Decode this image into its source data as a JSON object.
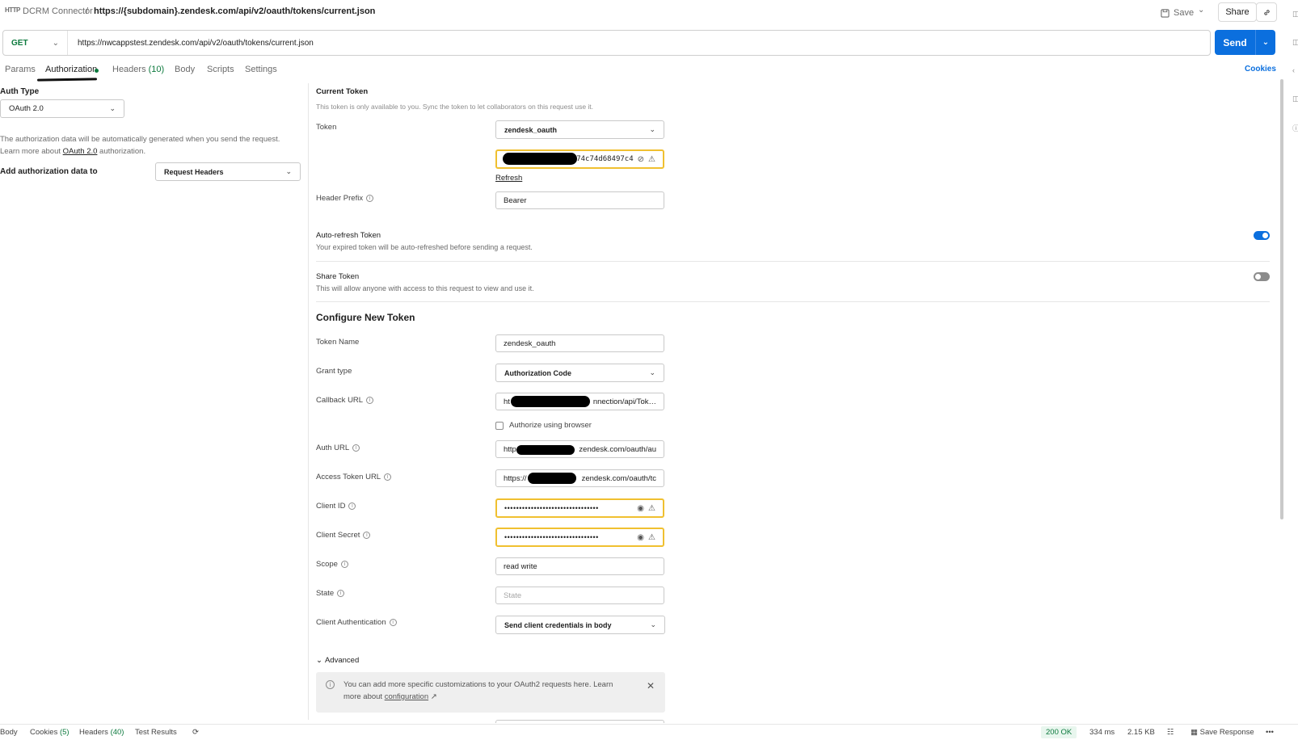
{
  "header": {
    "http_badge": "HTTP",
    "collection": "DCRM Connector",
    "separator": "/",
    "title": "https://{subdomain}.zendesk.com/api/v2/oauth/tokens/current.json",
    "save_label": "Save",
    "share_label": "Share"
  },
  "request": {
    "method": "GET",
    "url": "https://nwcappstest.zendesk.com/api/v2/oauth/tokens/current.json",
    "send_label": "Send"
  },
  "tabs": [
    {
      "label": "Params",
      "active": false
    },
    {
      "label": "Authorization",
      "active": true
    },
    {
      "label": "Headers",
      "count": "(10)",
      "active": false
    },
    {
      "label": "Body",
      "active": false
    },
    {
      "label": "Scripts",
      "active": false
    },
    {
      "label": "Settings",
      "active": false
    }
  ],
  "cookies_label": "Cookies",
  "auth": {
    "type_label": "Auth Type",
    "type_value": "OAuth 2.0",
    "info_line1": "The authorization data will be automatically generated when you send the request.",
    "info_prefix": "Learn more about ",
    "info_link": "OAuth 2.0",
    "info_suffix": " authorization.",
    "add_to_label": "Add authorization data to",
    "add_to_value": "Request Headers"
  },
  "current_token": {
    "title": "Current Token",
    "note": "This token is only available to you. Sync the token to let collaborators on this request use it.",
    "token_label": "Token",
    "token_name": "zendesk_oauth",
    "token_value": "74c74d68497c4",
    "refresh_label": "Refresh",
    "header_prefix_label": "Header Prefix",
    "header_prefix_value": "Bearer",
    "auto_refresh_title": "Auto-refresh Token",
    "auto_refresh_desc": "Your expired token will be auto-refreshed before sending a request.",
    "auto_refresh_on": true,
    "share_title": "Share Token",
    "share_desc": "This will allow anyone with access to this request to view and use it.",
    "share_on": false
  },
  "configure": {
    "title": "Configure New Token",
    "token_name_label": "Token Name",
    "token_name_value": "zendesk_oauth",
    "grant_type_label": "Grant type",
    "grant_type_value": "Authorization Code",
    "callback_label": "Callback URL",
    "callback_start": "ht",
    "callback_value": "nnection/api/Tok…",
    "authorize_browser_label": "Authorize using browser",
    "auth_url_label": "Auth URL",
    "auth_url_start": "http",
    "auth_url_value": "zendesk.com/oauth/au",
    "access_token_url_label": "Access Token URL",
    "access_token_url_start": "https://",
    "access_token_url_value": "zendesk.com/oauth/tc",
    "client_id_label": "Client ID",
    "client_id_value": "••••••••••••••••••••••••••••••••",
    "client_secret_label": "Client Secret",
    "client_secret_value": "••••••••••••••••••••••••••••••••",
    "scope_label": "Scope",
    "scope_value": "read write",
    "state_label": "State",
    "state_placeholder": "State",
    "client_auth_label": "Client Authentication",
    "client_auth_value": "Send client credentials in body",
    "advanced_label": "Advanced",
    "advanced_note_prefix": "You can add more specific customizations to your OAuth2 requests here. Learn more about ",
    "advanced_note_link": "configuration",
    "advanced_note_suffix": " ↗"
  },
  "footer": {
    "body": "Body",
    "cookies": "Cookies",
    "cookies_count": "(5)",
    "headers": "Headers",
    "headers_count": "(40)",
    "test_results": "Test Results",
    "status": "200 OK",
    "time": "334 ms",
    "size": "2.15 KB",
    "save_response": "Save Response",
    "more": "•••"
  },
  "colors": {
    "accent": "#0b6fde",
    "success": "#0d7a3e",
    "warning_border": "#f0c030"
  }
}
